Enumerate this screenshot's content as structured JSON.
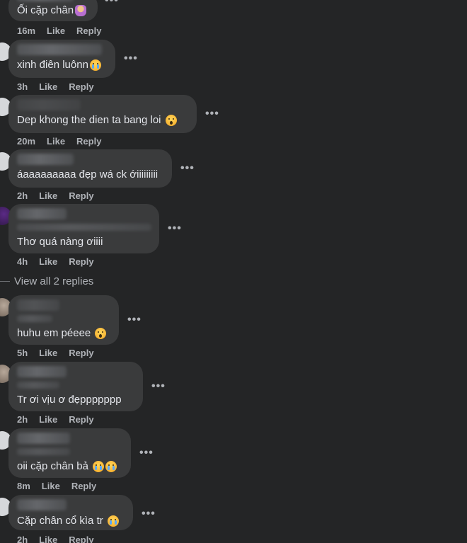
{
  "comments": [
    {
      "text": "Ối cặp chân",
      "emojis": [
        "person"
      ],
      "time": "16m",
      "like": "Like",
      "reply": "Reply"
    },
    {
      "text": "xinh điên luônn",
      "emojis": [
        "cry"
      ],
      "time": "3h",
      "like": "Like",
      "reply": "Reply"
    },
    {
      "text": "Dep khong the dien ta bang loi",
      "emojis": [
        "wow"
      ],
      "time": "20m",
      "like": "Like",
      "reply": "Reply"
    },
    {
      "text": "áaaaaaaaaa đẹp wá ck ớiiiiiiiii",
      "emojis": [],
      "time": "2h",
      "like": "Like",
      "reply": "Reply"
    },
    {
      "text": "Thơ quá nàng ơiiii",
      "emojis": [],
      "time": "4h",
      "like": "Like",
      "reply": "Reply"
    },
    {
      "text": "huhu em péeee",
      "emojis": [
        "wow"
      ],
      "time": "5h",
      "like": "Like",
      "reply": "Reply"
    },
    {
      "text": "Tr ơi vịu ơ đẹppppppp",
      "emojis": [],
      "time": "2h",
      "like": "Like",
      "reply": "Reply"
    },
    {
      "text": "oii cặp chân bả",
      "emojis": [
        "cry",
        "cry"
      ],
      "time": "8m",
      "like": "Like",
      "reply": "Reply"
    },
    {
      "text": "Cặp chân cổ kìa tr",
      "emojis": [
        "cry"
      ],
      "time": "2h",
      "like": "Like",
      "reply": "Reply"
    }
  ],
  "view_replies": "View all 2 replies",
  "more_icon": "•••"
}
